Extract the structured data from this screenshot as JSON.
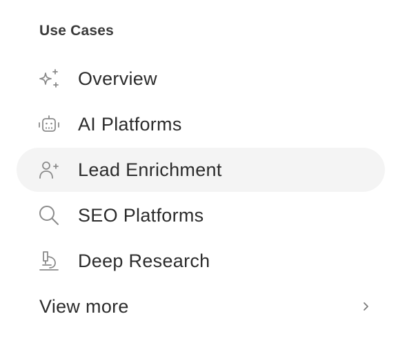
{
  "section": {
    "title": "Use Cases"
  },
  "items": [
    {
      "label": "Overview",
      "icon": "sparkles-icon",
      "active": false
    },
    {
      "label": "AI Platforms",
      "icon": "robot-icon",
      "active": false
    },
    {
      "label": "Lead Enrichment",
      "icon": "user-plus-icon",
      "active": true
    },
    {
      "label": "SEO Platforms",
      "icon": "search-icon",
      "active": false
    },
    {
      "label": "Deep Research",
      "icon": "microscope-icon",
      "active": false
    }
  ],
  "view_more": {
    "label": "View more",
    "icon": "chevron-right-icon"
  },
  "colors": {
    "text": "#2b2b2b",
    "icon": "#8a8a8a",
    "active_bg": "#f4f4f4",
    "heading": "#3a3a3a"
  }
}
